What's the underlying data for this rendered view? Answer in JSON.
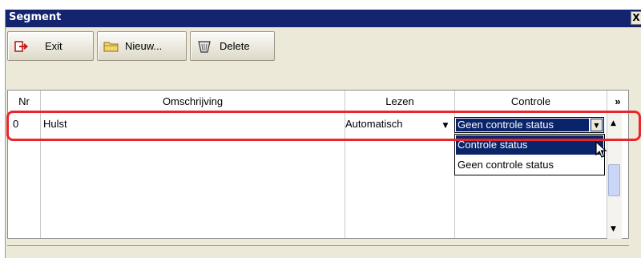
{
  "window": {
    "title": "Segment",
    "close_glyph": "X"
  },
  "toolbar": {
    "exit_label": "Exit",
    "new_label": "Nieuw...",
    "delete_label": "Delete",
    "icons": [
      "exit-icon",
      "folder-icon",
      "trash-icon"
    ]
  },
  "grid": {
    "headers": {
      "nr": "Nr",
      "omschrijving": "Omschrijving",
      "lezen": "Lezen",
      "controle": "Controle",
      "more": "»"
    },
    "rows": [
      {
        "nr": "0",
        "omschrijving": "Hulst",
        "lezen": "Automatisch",
        "controle": "Geen controle status"
      }
    ]
  },
  "controle_dropdown": {
    "options": [
      "Controle status",
      "Geen controle status"
    ],
    "highlighted_index": 0
  },
  "colors": {
    "titlebar": "#14246e",
    "selection": "#0a246a",
    "highlight_annotation": "#e8262b",
    "window_bg": "#ece9d8"
  }
}
